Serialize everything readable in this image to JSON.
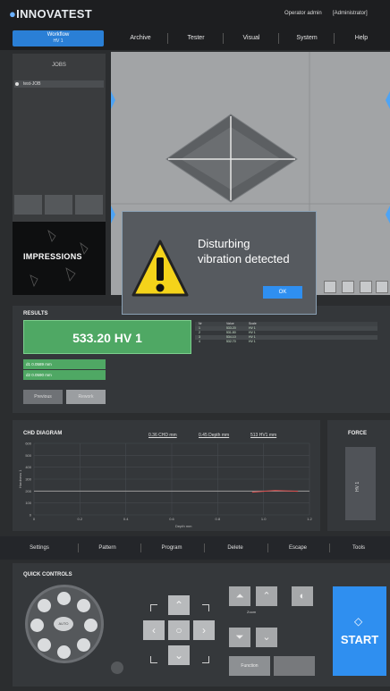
{
  "app": {
    "logo": "INNOVATEST",
    "operator": "Operator admin",
    "role": "[Administrator]"
  },
  "workflow": {
    "label": "Workflow",
    "sub": "HV 1"
  },
  "nav": [
    "Archive",
    "Tester",
    "Visual",
    "System",
    "Help"
  ],
  "jobs": {
    "header": "JOBS",
    "items": [
      "test-JOB"
    ]
  },
  "impressions": {
    "label": "IMPRESSIONS"
  },
  "modal": {
    "line1": "Disturbing",
    "line2": "vibration detected",
    "ok": "OK"
  },
  "results": {
    "title": "RESULTS",
    "hardness": "533.20 HV 1",
    "diag1": "d1 0.0589 mm",
    "diag2": "d2 0.0590 mm",
    "buttons": [
      "Previous",
      "Rework"
    ],
    "table_header": [
      "Nr",
      "Value",
      "Scale"
    ],
    "table_rows": [
      [
        "1",
        "533.20",
        "HV 1"
      ],
      [
        "2",
        "531.80",
        "HV 1"
      ],
      [
        "3",
        "534.10",
        "HV 1"
      ],
      [
        "4",
        "532.70",
        "HV 1"
      ]
    ]
  },
  "chd": {
    "title": "CHD DIAGRAM",
    "links": [
      "0.36 CHD mm",
      "0.45 Depth mm",
      "513 HV1 mm"
    ],
    "ylabel": "Hardness 1",
    "xlabel": "Depth mm"
  },
  "chart_data": {
    "type": "line",
    "xlabel": "Depth mm",
    "ylabel": "Hardness 1",
    "x_ticks": [
      "0",
      "0.2",
      "0.4",
      "0.6",
      "0.8",
      "1.0",
      "1.2"
    ],
    "y_ticks": [
      "600",
      "500",
      "400",
      "300",
      "200",
      "100",
      "0"
    ],
    "xlim": [
      0,
      1.2
    ],
    "ylim": [
      0,
      600
    ],
    "series": [
      {
        "x": [
          0,
          1.2
        ],
        "y": [
          200,
          200
        ],
        "color": "#9a9a9a"
      },
      {
        "x": [
          0.95,
          1.05,
          1.15
        ],
        "y": [
          190,
          205,
          198
        ],
        "color": "#d84a4a"
      }
    ],
    "grid": true
  },
  "force": {
    "title": "FORCE",
    "value": "HV 1"
  },
  "toolbar": [
    "Settings",
    "Pattern",
    "Program",
    "Delete",
    "Escape",
    "Tools"
  ],
  "quick": {
    "title": "QUICK CONTROLS",
    "dial_center": "AUTO",
    "zoom_label": "Zoom",
    "function_label": "Function",
    "start": "START"
  },
  "colors": {
    "accent": "#2f8ff0",
    "result_green": "#4fa864",
    "warning_yellow": "#f4d31a"
  }
}
